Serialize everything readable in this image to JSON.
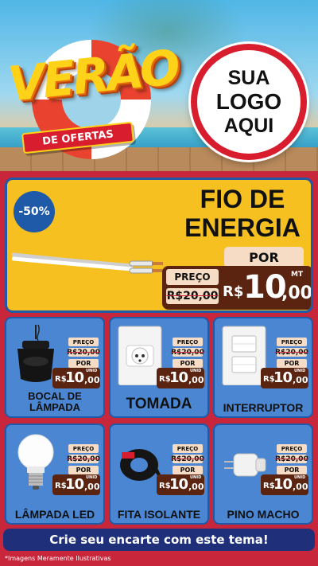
{
  "header": {
    "headline": "VERÃO",
    "subheadline": "DE OFERTAS",
    "logo_lines": [
      "SUA",
      "LOGO",
      "AQUI"
    ]
  },
  "featured": {
    "discount_badge": "-50%",
    "title_line1": "FIO DE",
    "title_line2": "ENERGIA",
    "preco_label": "PREÇO",
    "old_price": "R$20,00",
    "por_label": "POR",
    "currency": "R$",
    "price_int": "10",
    "price_dec": ",00",
    "unit": "MT"
  },
  "products": [
    {
      "name": "BOCAL DE LÂMPADA",
      "preco_label": "PREÇO",
      "old_price": "R$20,00",
      "por_label": "POR",
      "currency": "R$",
      "price_int": "10",
      "price_dec": ",00",
      "unit": "UNID"
    },
    {
      "name": "TOMADA",
      "preco_label": "PREÇO",
      "old_price": "R$20,00",
      "por_label": "POR",
      "currency": "R$",
      "price_int": "10",
      "price_dec": ",00",
      "unit": "UNID"
    },
    {
      "name": "INTERRUPTOR",
      "preco_label": "PREÇO",
      "old_price": "R$20,00",
      "por_label": "POR",
      "currency": "R$",
      "price_int": "10",
      "price_dec": ",00",
      "unit": "UNID"
    },
    {
      "name": "LÂMPADA LED",
      "preco_label": "PREÇO",
      "old_price": "R$20,00",
      "por_label": "POR",
      "currency": "R$",
      "price_int": "10",
      "price_dec": ",00",
      "unit": "UNID"
    },
    {
      "name": "FITA ISOLANTE",
      "preco_label": "PREÇO",
      "old_price": "R$20,00",
      "por_label": "POR",
      "currency": "R$",
      "price_int": "10",
      "price_dec": ",00",
      "unit": "UNID"
    },
    {
      "name": "PINO MACHO",
      "preco_label": "PREÇO",
      "old_price": "R$20,00",
      "por_label": "POR",
      "currency": "R$",
      "price_int": "10",
      "price_dec": ",00",
      "unit": "UNID"
    }
  ],
  "footer": {
    "cta": "Crie seu encarte com este tema!",
    "disclaimer": "*Imagens Meramente Ilustrativas"
  },
  "colors": {
    "background": "#c7263b",
    "featured_bg": "#f6c021",
    "card_bg": "#4a86d2",
    "price_box": "#5a2410",
    "label_bg": "#f6dcc4",
    "cta_bg": "#1f2f7a"
  }
}
